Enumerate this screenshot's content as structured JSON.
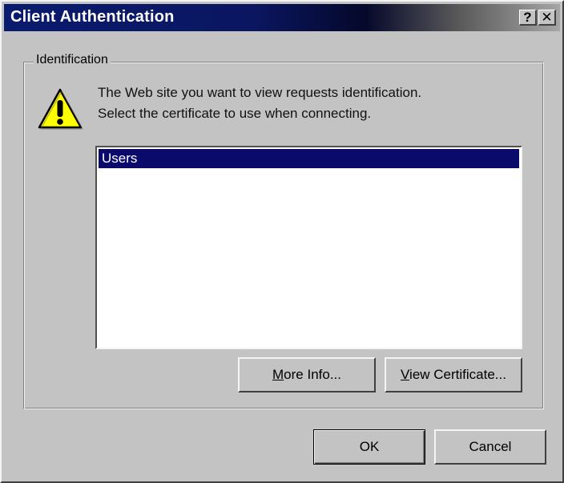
{
  "window": {
    "title": "Client Authentication",
    "help_button": "?",
    "close_button": "✕"
  },
  "identification": {
    "group_label": "Identification",
    "icon": "warning-icon",
    "message_line1": "The Web site you want to view requests identification.",
    "message_line2": "Select the certificate to use when connecting."
  },
  "certificates": {
    "items": [
      "Users"
    ],
    "selected": "Users"
  },
  "buttons": {
    "more_info": {
      "label": "More Info...",
      "accel": "M",
      "rest": "ore Info..."
    },
    "view_certificate": {
      "label": "View Certificate...",
      "accel": "V",
      "rest": "iew Certificate..."
    },
    "ok": "OK",
    "cancel": "Cancel"
  },
  "colors": {
    "title_start": "#0a1a6e",
    "title_end": "#a6a6a6",
    "selection": "#0a0a6a",
    "face": "#c3c3c3",
    "warning_yellow": "#ffff00"
  }
}
